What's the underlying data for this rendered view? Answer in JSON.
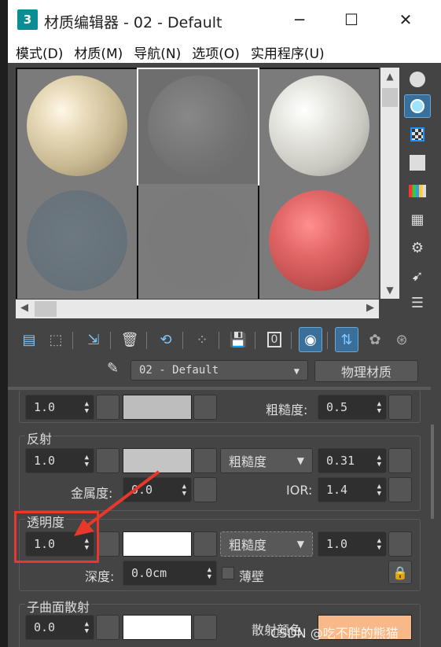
{
  "window": {
    "app_icon_text": "3",
    "title": "材质编辑器 - 02 - Default",
    "minimize": "─",
    "maximize": "☐",
    "close": "✕"
  },
  "menu": [
    {
      "label": "模式(D)"
    },
    {
      "label": "材质(M)"
    },
    {
      "label": "导航(N)"
    },
    {
      "label": "选项(O)"
    },
    {
      "label": "实用程序(U)"
    }
  ],
  "material": {
    "name": "02 - Default",
    "type_button": "物理材质"
  },
  "params": {
    "base": {
      "weight": "1.0",
      "roughness_label": "粗糙度:",
      "roughness": "0.5"
    },
    "reflection": {
      "title": "反射",
      "weight": "1.0",
      "mode": "粗糙度",
      "roughness": "0.31",
      "metalness_label": "金属度:",
      "metalness": "0.0",
      "ior_label": "IOR:",
      "ior": "1.4"
    },
    "transparency": {
      "title": "透明度",
      "weight": "1.0",
      "mode": "粗糙度",
      "roughness": "1.0",
      "depth_label": "深度:",
      "depth": "0.0cm",
      "thin_wall": "薄壁"
    },
    "sss": {
      "title": "子曲面散射",
      "weight": "0.0",
      "scatter_color_label": "散射颜色"
    }
  },
  "colors": {
    "base_swatch": "#bdbdbd",
    "reflect_swatch": "#c4c4c4",
    "trans_swatch": "#ffffff",
    "sss_swatch": "#ffffff",
    "scatter_color": "#f9b887",
    "accent": "#1e90ff",
    "annotation": "#e8382c"
  },
  "watermark": "CSDN @吃不胖的熊猫"
}
